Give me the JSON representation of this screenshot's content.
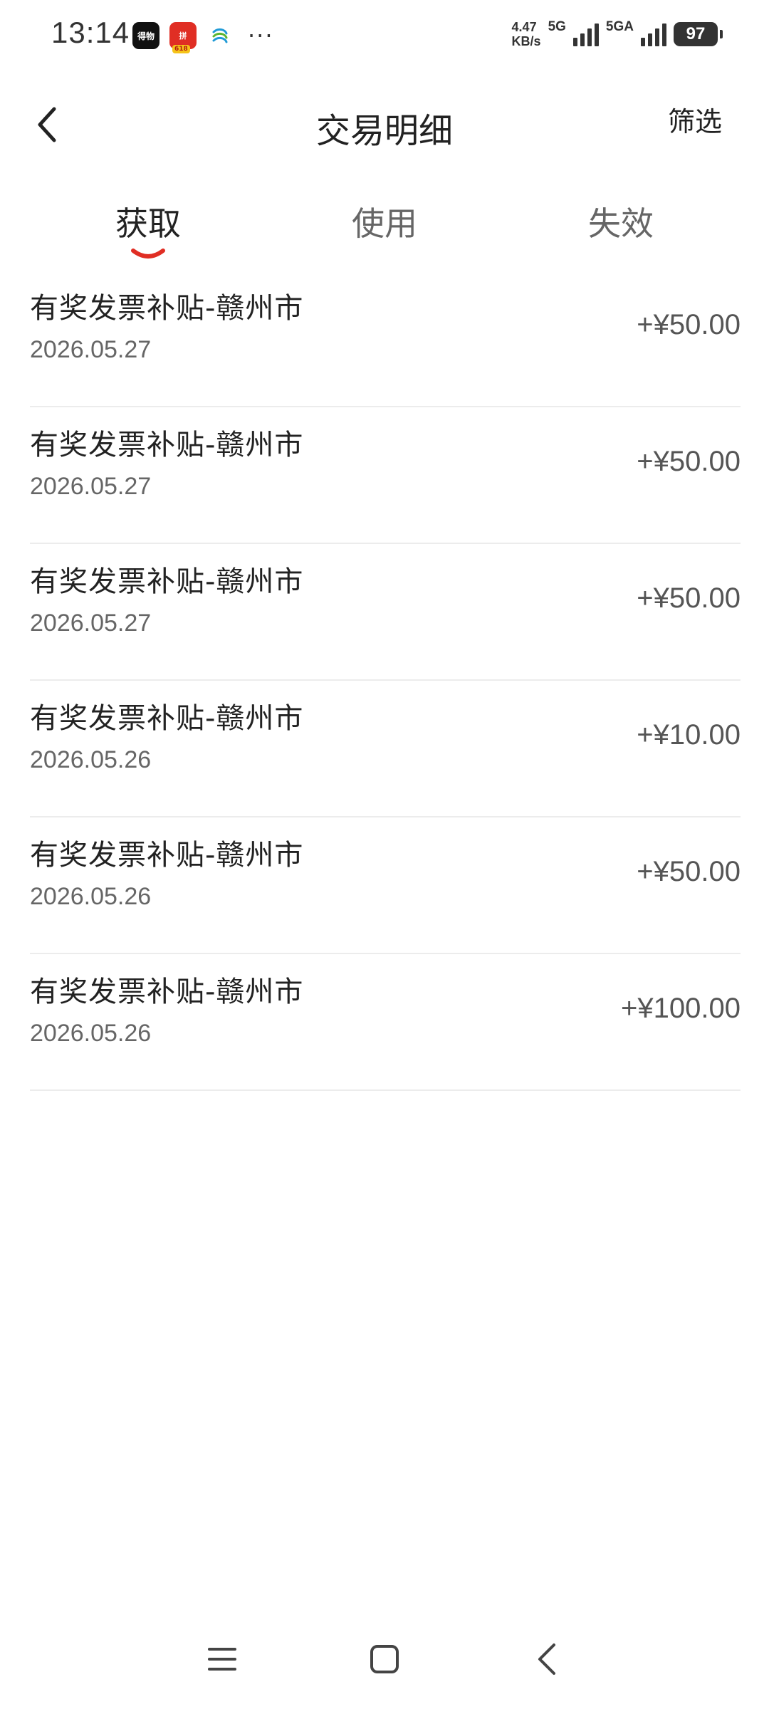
{
  "status_bar": {
    "time": "13:14",
    "app_icons": [
      {
        "name": "dewu-app-icon",
        "text": "得物"
      },
      {
        "name": "pinduoduo-app-icon",
        "text": "拼",
        "badge": "618"
      },
      {
        "name": "china-mobile-icon",
        "text": ""
      }
    ],
    "more": "···",
    "net_speed_value": "4.47",
    "net_speed_unit": "KB/s",
    "network_1": "5G",
    "network_2": "5GA",
    "battery": "97"
  },
  "header": {
    "title": "交易明细",
    "filter_label": "筛选",
    "back_icon": "chevron-left-icon"
  },
  "tabs": [
    {
      "label": "获取",
      "active": true
    },
    {
      "label": "使用",
      "active": false
    },
    {
      "label": "失效",
      "active": false
    }
  ],
  "accent_color": "#e02e24",
  "transactions": [
    {
      "title": "有奖发票补贴-赣州市",
      "date": "2026.05.27",
      "amount": "+¥50.00"
    },
    {
      "title": "有奖发票补贴-赣州市",
      "date": "2026.05.27",
      "amount": "+¥50.00"
    },
    {
      "title": "有奖发票补贴-赣州市",
      "date": "2026.05.27",
      "amount": "+¥50.00"
    },
    {
      "title": "有奖发票补贴-赣州市",
      "date": "2026.05.26",
      "amount": "+¥10.00"
    },
    {
      "title": "有奖发票补贴-赣州市",
      "date": "2026.05.26",
      "amount": "+¥50.00"
    },
    {
      "title": "有奖发票补贴-赣州市",
      "date": "2026.05.26",
      "amount": "+¥100.00"
    }
  ],
  "nav_bar": {
    "items": [
      {
        "name": "menu-icon"
      },
      {
        "name": "home-square-icon"
      },
      {
        "name": "back-triangle-icon"
      }
    ]
  }
}
